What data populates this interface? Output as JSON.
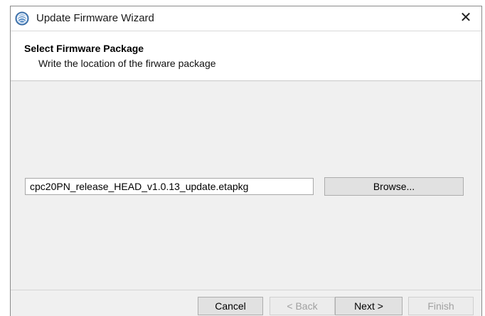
{
  "window": {
    "title": "Update Firmware Wizard",
    "close_glyph": "✕",
    "icon": "firmware-wizard-icon"
  },
  "header": {
    "title": "Select Firmware Package",
    "description": "Write the location of the firware package"
  },
  "content": {
    "path_value": "cpc20PN_release_HEAD_v1.0.13_update.etapkg",
    "browse_label": "Browse..."
  },
  "footer": {
    "cancel_label": "Cancel",
    "back_label": "< Back",
    "next_label": "Next >",
    "finish_label": "Finish"
  },
  "colors": {
    "body_background": "#f0f0f0",
    "button_background": "#e1e1e1",
    "disabled_text": "#a0a0a0"
  }
}
